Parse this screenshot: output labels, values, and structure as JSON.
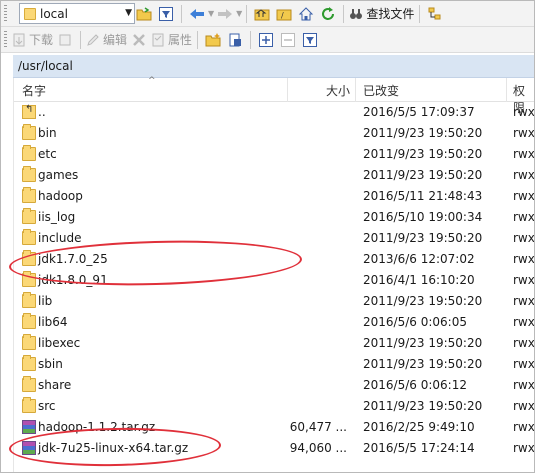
{
  "toolbar": {
    "path_combo_value": "local",
    "find_files_label": "查找文件",
    "download_label": "下载",
    "edit_label": "编辑",
    "properties_label": "属性"
  },
  "path_bar": {
    "path": "/usr/local"
  },
  "columns": {
    "name": "名字",
    "size": "大小",
    "modified": "已改变",
    "permissions": "权限"
  },
  "files": [
    {
      "icon": "parent-dir-icon",
      "name": "..",
      "size": "",
      "modified": "2016/5/5 17:09:37",
      "perm": "rwx"
    },
    {
      "icon": "folder-icon",
      "name": "bin",
      "size": "",
      "modified": "2011/9/23 19:50:20",
      "perm": "rwx"
    },
    {
      "icon": "folder-icon",
      "name": "etc",
      "size": "",
      "modified": "2011/9/23 19:50:20",
      "perm": "rwx"
    },
    {
      "icon": "folder-icon",
      "name": "games",
      "size": "",
      "modified": "2011/9/23 19:50:20",
      "perm": "rwx"
    },
    {
      "icon": "folder-icon",
      "name": "hadoop",
      "size": "",
      "modified": "2016/5/11 21:48:43",
      "perm": "rwx"
    },
    {
      "icon": "folder-icon",
      "name": "iis_log",
      "size": "",
      "modified": "2016/5/10 19:00:34",
      "perm": "rwx"
    },
    {
      "icon": "folder-icon",
      "name": "include",
      "size": "",
      "modified": "2011/9/23 19:50:20",
      "perm": "rwx"
    },
    {
      "icon": "folder-icon",
      "name": "jdk1.7.0_25",
      "size": "",
      "modified": "2013/6/6 12:07:02",
      "perm": "rwx"
    },
    {
      "icon": "folder-icon",
      "name": "jdk1.8.0_91",
      "size": "",
      "modified": "2016/4/1 16:10:20",
      "perm": "rwx"
    },
    {
      "icon": "folder-icon",
      "name": "lib",
      "size": "",
      "modified": "2011/9/23 19:50:20",
      "perm": "rwx"
    },
    {
      "icon": "folder-icon",
      "name": "lib64",
      "size": "",
      "modified": "2016/5/6 0:06:05",
      "perm": "rwx"
    },
    {
      "icon": "folder-icon",
      "name": "libexec",
      "size": "",
      "modified": "2011/9/23 19:50:20",
      "perm": "rwx"
    },
    {
      "icon": "folder-icon",
      "name": "sbin",
      "size": "",
      "modified": "2011/9/23 19:50:20",
      "perm": "rwx"
    },
    {
      "icon": "folder-icon",
      "name": "share",
      "size": "",
      "modified": "2016/5/6 0:06:12",
      "perm": "rwx"
    },
    {
      "icon": "folder-icon",
      "name": "src",
      "size": "",
      "modified": "2011/9/23 19:50:20",
      "perm": "rwx"
    },
    {
      "icon": "archive-icon",
      "name": "hadoop-1.1.2.tar.gz",
      "size": "60,477 ...",
      "modified": "2016/2/25 9:49:10",
      "perm": "rwx"
    },
    {
      "icon": "archive-icon",
      "name": "jdk-7u25-linux-x64.tar.gz",
      "size": "94,060 ...",
      "modified": "2016/5/5 17:24:14",
      "perm": "rwx"
    }
  ],
  "colors": {
    "path_bar_bg": "#d9e5f3",
    "annotation_red": "#e0303a",
    "folder_yellow": "#fbd877"
  }
}
